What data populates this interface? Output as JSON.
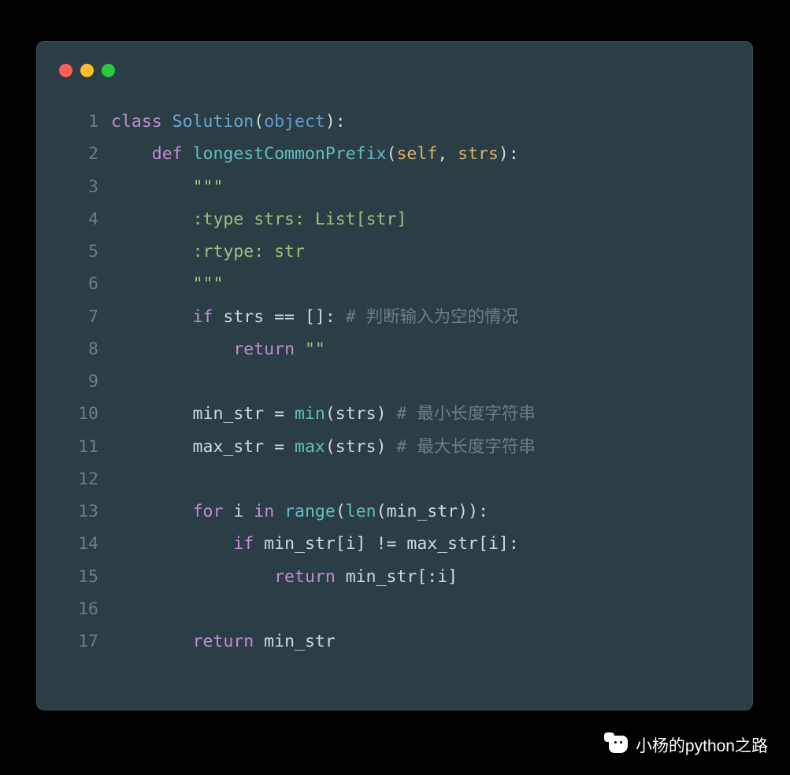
{
  "traffic_lights": {
    "red": "#ff5f56",
    "yellow": "#ffbd2e",
    "green": "#27c93f"
  },
  "code": {
    "lines": [
      {
        "n": "1",
        "tokens": [
          [
            "kw",
            "class "
          ],
          [
            "cls",
            "Solution"
          ],
          [
            "pun",
            "("
          ],
          [
            "lit",
            "object"
          ],
          [
            "pun",
            "):"
          ]
        ]
      },
      {
        "n": "2",
        "tokens": [
          [
            "pun",
            "    "
          ],
          [
            "kw",
            "def "
          ],
          [
            "fn",
            "longestCommonPrefix"
          ],
          [
            "pun",
            "("
          ],
          [
            "par",
            "self"
          ],
          [
            "pun",
            ", "
          ],
          [
            "par",
            "strs"
          ],
          [
            "pun",
            "):"
          ]
        ]
      },
      {
        "n": "3",
        "tokens": [
          [
            "pun",
            "        "
          ],
          [
            "str",
            "\"\"\""
          ]
        ]
      },
      {
        "n": "4",
        "tokens": [
          [
            "pun",
            "        "
          ],
          [
            "str",
            ":type strs: List[str]"
          ]
        ]
      },
      {
        "n": "5",
        "tokens": [
          [
            "pun",
            "        "
          ],
          [
            "str",
            ":rtype: str"
          ]
        ]
      },
      {
        "n": "6",
        "tokens": [
          [
            "pun",
            "        "
          ],
          [
            "str",
            "\"\"\""
          ]
        ]
      },
      {
        "n": "7",
        "tokens": [
          [
            "pun",
            "        "
          ],
          [
            "kw",
            "if"
          ],
          [
            "pun",
            " strs == []: "
          ],
          [
            "cmt",
            "# 判断输入为空的情况"
          ]
        ]
      },
      {
        "n": "8",
        "tokens": [
          [
            "pun",
            "            "
          ],
          [
            "kw",
            "return"
          ],
          [
            "pun",
            " "
          ],
          [
            "str",
            "\"\""
          ]
        ]
      },
      {
        "n": "9",
        "tokens": [
          [
            "pun",
            ""
          ]
        ]
      },
      {
        "n": "10",
        "tokens": [
          [
            "pun",
            "        min_str = "
          ],
          [
            "fn",
            "min"
          ],
          [
            "pun",
            "(strs) "
          ],
          [
            "cmt",
            "# 最小长度字符串"
          ]
        ]
      },
      {
        "n": "11",
        "tokens": [
          [
            "pun",
            "        max_str = "
          ],
          [
            "fn",
            "max"
          ],
          [
            "pun",
            "(strs) "
          ],
          [
            "cmt",
            "# 最大长度字符串"
          ]
        ]
      },
      {
        "n": "12",
        "tokens": [
          [
            "pun",
            ""
          ]
        ]
      },
      {
        "n": "13",
        "tokens": [
          [
            "pun",
            "        "
          ],
          [
            "kw",
            "for"
          ],
          [
            "pun",
            " i "
          ],
          [
            "kw",
            "in"
          ],
          [
            "pun",
            " "
          ],
          [
            "fn",
            "range"
          ],
          [
            "pun",
            "("
          ],
          [
            "fn",
            "len"
          ],
          [
            "pun",
            "(min_str)):"
          ]
        ]
      },
      {
        "n": "14",
        "tokens": [
          [
            "pun",
            "            "
          ],
          [
            "kw",
            "if"
          ],
          [
            "pun",
            " min_str[i] != max_str[i]:"
          ]
        ]
      },
      {
        "n": "15",
        "tokens": [
          [
            "pun",
            "                "
          ],
          [
            "kw",
            "return"
          ],
          [
            "pun",
            " min_str[:i]"
          ]
        ]
      },
      {
        "n": "16",
        "tokens": [
          [
            "pun",
            ""
          ]
        ]
      },
      {
        "n": "17",
        "tokens": [
          [
            "pun",
            "        "
          ],
          [
            "kw",
            "return"
          ],
          [
            "pun",
            " min_str"
          ]
        ]
      }
    ]
  },
  "watermark": {
    "text": "小杨的python之路"
  }
}
